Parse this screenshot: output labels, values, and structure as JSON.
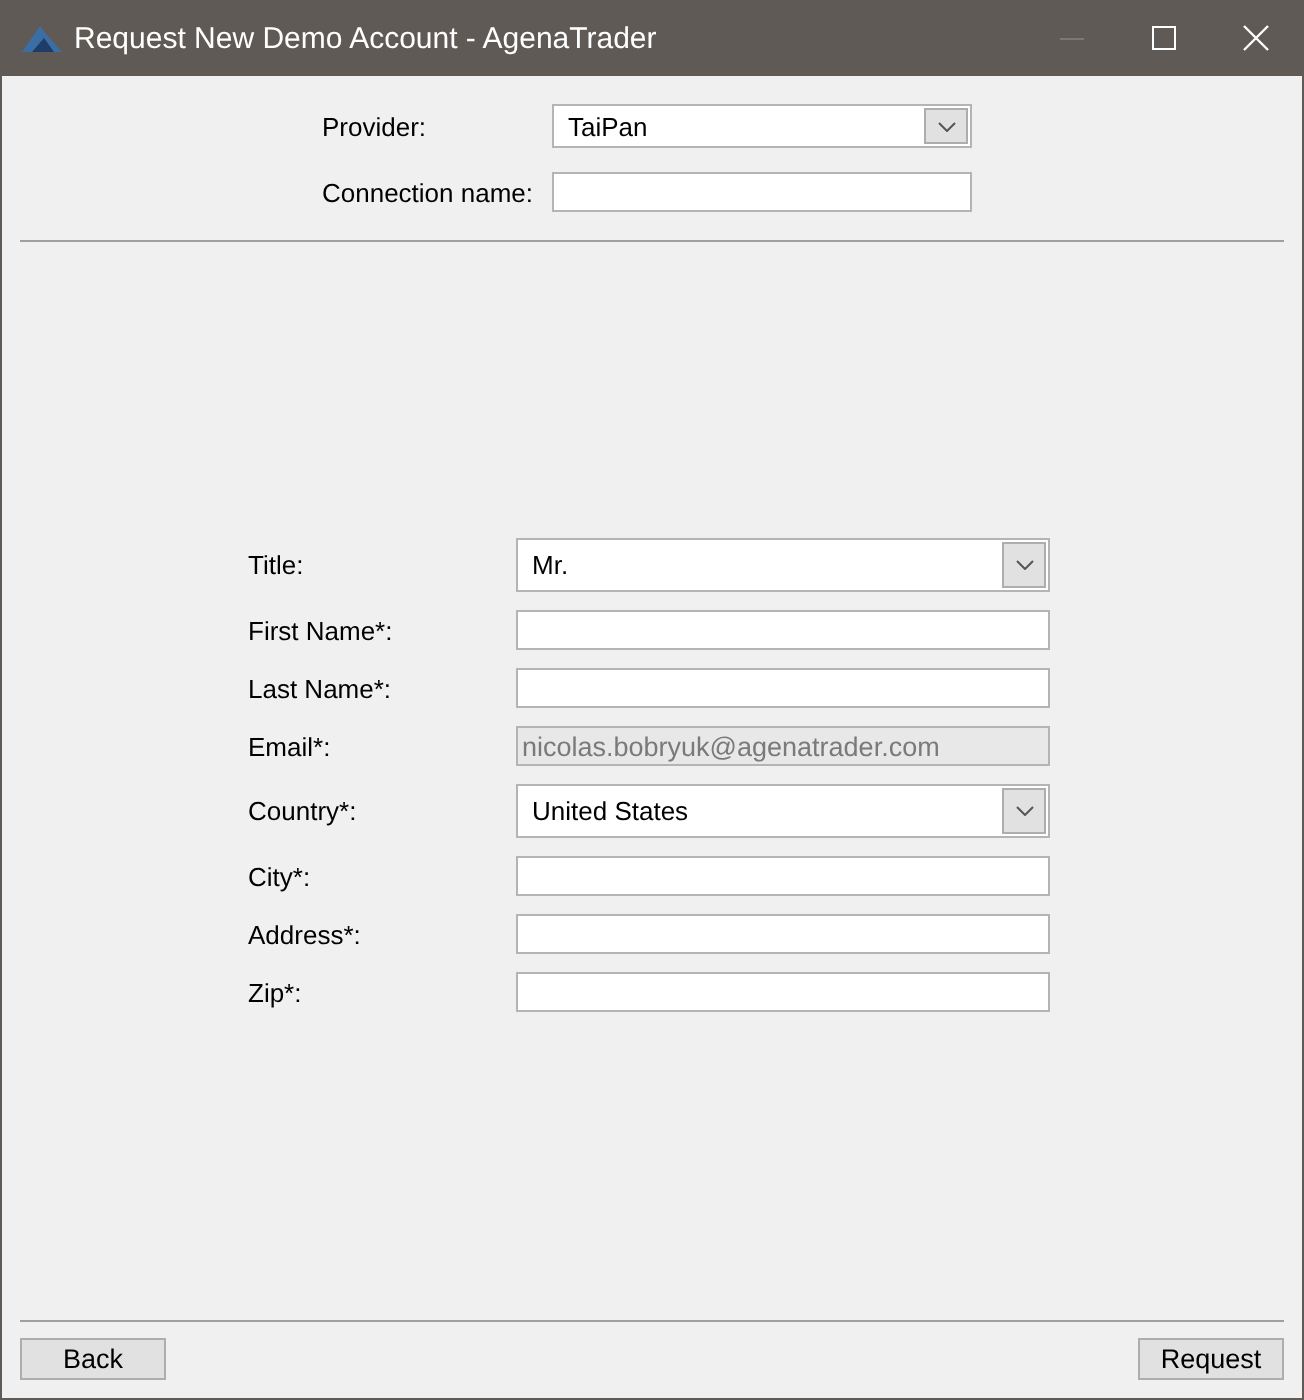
{
  "window": {
    "title": "Request New Demo Account - AgenaTrader"
  },
  "connection": [
    {
      "label": "Provider:",
      "kind": "select",
      "value": "TaiPan"
    },
    {
      "label": "Connection name:",
      "kind": "text"
    }
  ],
  "form": [
    {
      "label": "Title:",
      "kind": "select",
      "value": "Mr."
    },
    {
      "label": "First Name*:",
      "kind": "text"
    },
    {
      "label": "Last Name*:",
      "kind": "text"
    },
    {
      "label": "Email*:",
      "kind": "text",
      "value": "nicolas.bobryuk@agenatrader.com",
      "disabled": true
    },
    {
      "label": "Country*:",
      "kind": "select",
      "value": "United States"
    },
    {
      "label": "City*:",
      "kind": "text"
    },
    {
      "label": "Address*:",
      "kind": "text"
    },
    {
      "label": "Zip*:",
      "kind": "text"
    }
  ],
  "buttons": {
    "back": "Back",
    "request": "Request"
  }
}
